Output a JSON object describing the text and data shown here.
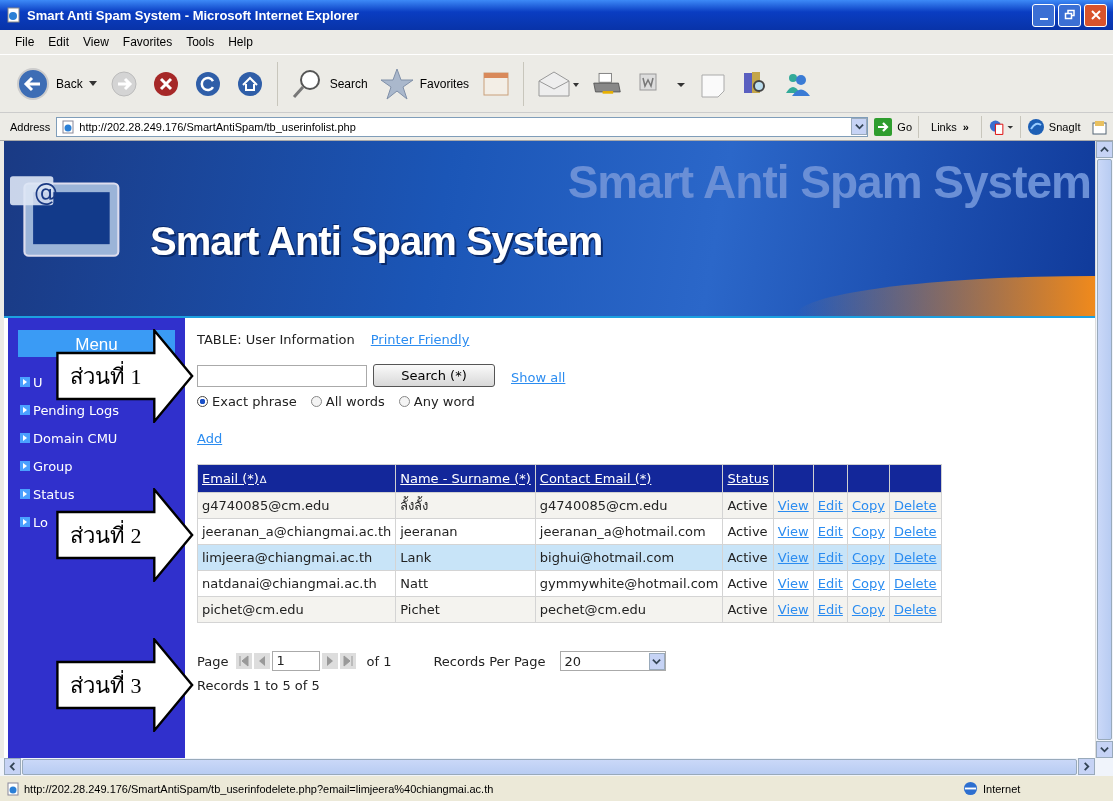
{
  "window": {
    "title": "Smart Anti Spam System - Microsoft Internet Explorer"
  },
  "menu_bar": [
    "File",
    "Edit",
    "View",
    "Favorites",
    "Tools",
    "Help"
  ],
  "toolbar": {
    "back": "Back",
    "search": "Search",
    "favorites": "Favorites"
  },
  "address_bar": {
    "label": "Address",
    "url": "http://202.28.249.176/SmartAntiSpam/tb_userinfolist.php",
    "go": "Go",
    "links": "Links",
    "links_more": "»",
    "snagit": "SnagIt"
  },
  "banner": {
    "logo_mark": "@",
    "title": "Smart Anti Spam System",
    "background_text": "Smart Anti Spam System"
  },
  "sidebar": {
    "heading": "Menu",
    "items": [
      {
        "label": "U"
      },
      {
        "label": "Pending Logs"
      },
      {
        "label": "Domain CMU"
      },
      {
        "label": "Group"
      },
      {
        "label": "Status"
      },
      {
        "label": "Lo"
      }
    ]
  },
  "page": {
    "table_label": "TABLE: User Information",
    "printer_link": "Printer Friendly",
    "search_button": "Search (*)",
    "show_all": "Show all",
    "add_link": "Add",
    "search_modes": [
      {
        "label": "Exact phrase",
        "selected": true
      },
      {
        "label": "All words",
        "selected": false
      },
      {
        "label": "Any word",
        "selected": false
      }
    ]
  },
  "table": {
    "columns": [
      "Email (*)",
      "Name - Surname (*)",
      "Contact Email (*)",
      "Status"
    ],
    "sort_mark": "∆",
    "rows": [
      {
        "cells": [
          "g4740085@cm.edu",
          "ลั้งลั้ง",
          "g4740085@cm.edu",
          "Active"
        ],
        "actions": [
          "View",
          "Edit",
          "Copy",
          "Delete"
        ],
        "selected": false
      },
      {
        "cells": [
          "jeeranan_a@chiangmai.ac.th",
          "jeeranan",
          "jeeranan_a@hotmail.com",
          "Active"
        ],
        "actions": [
          "View",
          "Edit",
          "Copy",
          "Delete"
        ],
        "selected": false
      },
      {
        "cells": [
          "limjeera@chiangmai.ac.th",
          "Lank",
          "bighui@hotmail.com",
          "Active"
        ],
        "actions": [
          "View",
          "Edit",
          "Copy",
          "Delete"
        ],
        "selected": true
      },
      {
        "cells": [
          "natdanai@chiangmai.ac.th",
          "Natt",
          "gymmywhite@hotmail.com",
          "Active"
        ],
        "actions": [
          "View",
          "Edit",
          "Copy",
          "Delete"
        ],
        "selected": false
      },
      {
        "cells": [
          "pichet@cm.edu",
          "Pichet",
          "pechet@cm.edu",
          "Active"
        ],
        "actions": [
          "View",
          "Edit",
          "Copy",
          "Delete"
        ],
        "selected": false
      }
    ]
  },
  "pager": {
    "page_label": "Page",
    "page_value": "1",
    "of": "of 1",
    "per_page_label": "Records Per Page",
    "per_page_value": "20",
    "summary": "Records 1 to 5 of 5"
  },
  "status_bar": {
    "url": "http://202.28.249.176/SmartAntiSpam/tb_userinfodelete.php?email=limjeera%40chiangmai.ac.th",
    "zone": "Internet"
  },
  "annotations": [
    {
      "label": "ส่วนที่ 1"
    },
    {
      "label": "ส่วนที่ 2"
    },
    {
      "label": "ส่วนที่ 3"
    }
  ]
}
